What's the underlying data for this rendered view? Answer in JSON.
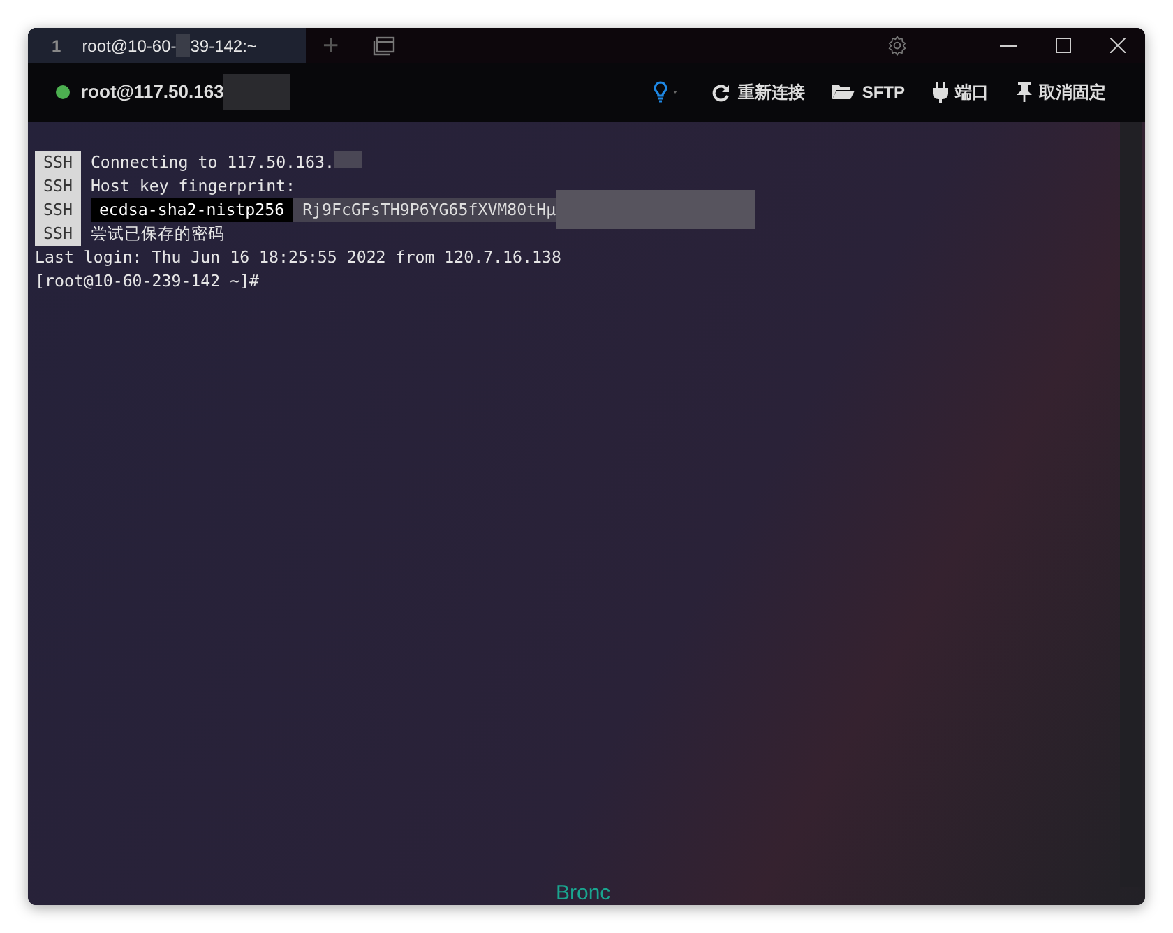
{
  "tabs": [
    {
      "index": "1",
      "title": "root@10-60-",
      "title_rest": "39-142:~",
      "selected": true
    }
  ],
  "tab_bar": {
    "new_tab": "+"
  },
  "toolbar": {
    "connected": true,
    "host": "root@117.50.163",
    "buttons": [
      {
        "kind": "reconnect",
        "label": "重新连接"
      },
      {
        "kind": "sftp",
        "label": "SFTP"
      },
      {
        "kind": "port",
        "label": "端口"
      },
      {
        "kind": "pin",
        "label": "取消固定"
      }
    ]
  },
  "terminal": {
    "lines": [
      {
        "kind": "ssh",
        "tag": "SSH",
        "text": "Connecting to 117.50.163.",
        "redacted": true
      },
      {
        "kind": "ssh",
        "tag": "SSH",
        "text": "Host key fingerprint:",
        "redacted": false
      },
      {
        "kind": "fingerprint",
        "tag": "SSH",
        "algo": "ecdsa-sha2-nistp256",
        "text": "Rj9FcGFsTH9P6YG65fXVM80tHµ",
        "redacted": true
      },
      {
        "kind": "ssh",
        "tag": "SSH",
        "text": "尝试已保存的密码",
        "redacted": false
      },
      {
        "kind": "plain",
        "text": "Last login: Thu Jun 16 18:25:55 2022 from 120.7.16.138"
      },
      {
        "kind": "plain",
        "text": "[root@10-60-239-142 ~]#"
      }
    ],
    "footer_text": "Bronc"
  }
}
